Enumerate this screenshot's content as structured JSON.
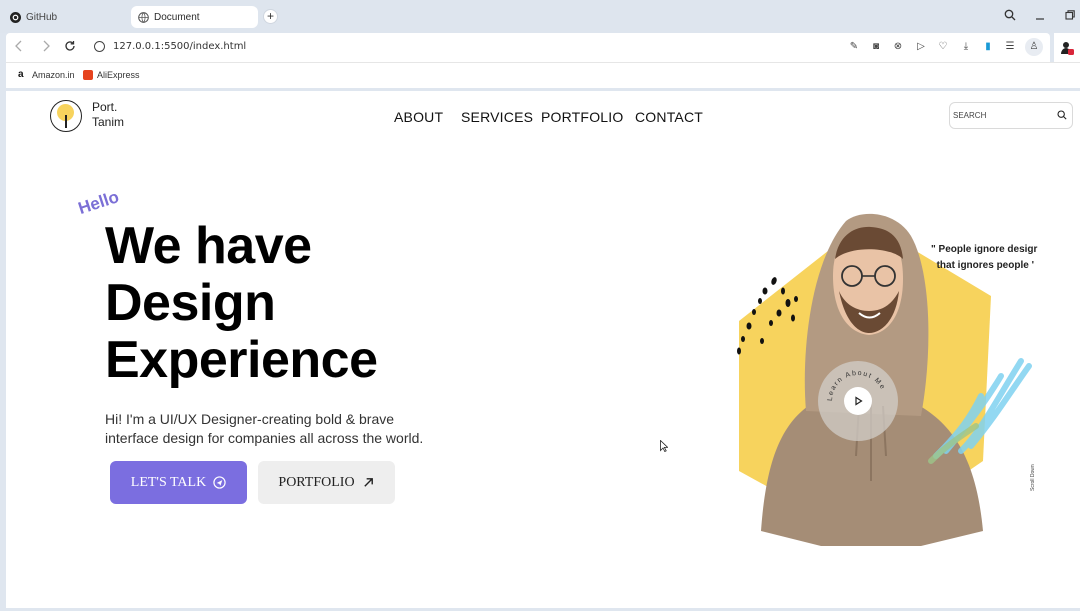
{
  "browser": {
    "tabs": [
      {
        "label": "GitHub"
      },
      {
        "label": "Document"
      }
    ],
    "url": "127.0.0.1:5500/index.html",
    "bookmarks": [
      {
        "label": "Amazon.in"
      },
      {
        "label": "AliExpress"
      }
    ]
  },
  "site": {
    "logo_line1": "Port.",
    "logo_line2": "Tanim",
    "nav": [
      "ABOUT",
      "SERVICES",
      "PORTFOLIO",
      "CONTACT"
    ],
    "search_placeholder": "SEARCH"
  },
  "hero": {
    "hello": "Hello",
    "headline": [
      "We have",
      "Design",
      "Experience"
    ],
    "subtext_line1": "Hi! I'm a UI/UX Designer-creating bold & brave",
    "subtext_line2": "interface design for companies all across the world.",
    "cta_primary": "LET'S TALK",
    "cta_secondary": "PORTFOLIO",
    "quote_line1": "\" People ignore desigr",
    "quote_line2": "that ignores people '",
    "play_label": "Learn About Me",
    "scroll_label": "Scroll Down"
  },
  "colors": {
    "accent": "#7b6ee0",
    "hello": "#7b6fd6",
    "hexagon": "#f7d35d"
  }
}
